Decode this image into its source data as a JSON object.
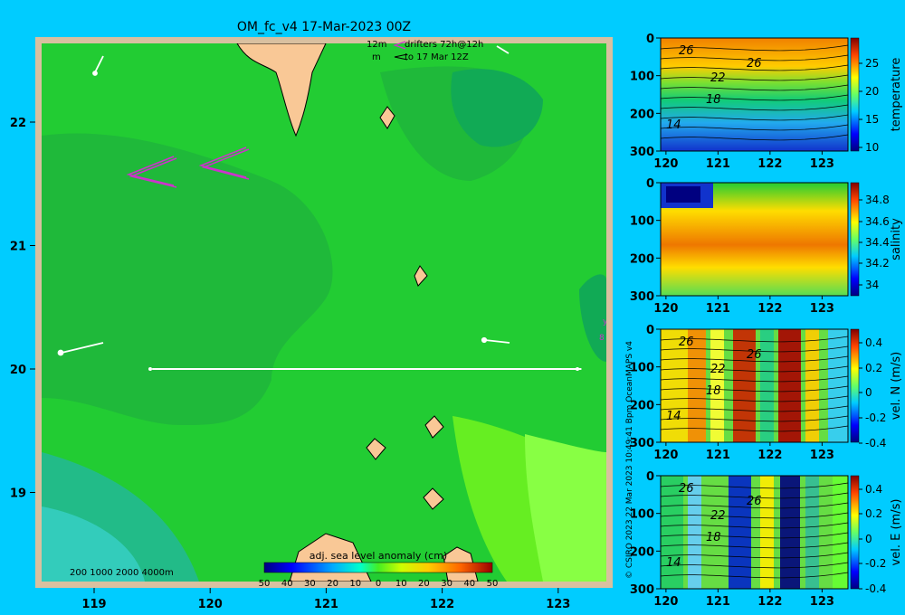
{
  "header": {
    "title": "OM_fc_v4  17-Mar-2023 00Z"
  },
  "drifter_legend": {
    "line1_a": "12m",
    "line1_b": "drifters 72h@12h",
    "line2_a": "m",
    "line2_b": "to 17 Mar 12Z"
  },
  "map": {
    "x_ticks": [
      "119",
      "120",
      "121",
      "122",
      "123"
    ],
    "y_ticks": [
      "22",
      "21",
      "20",
      "19"
    ],
    "colorbar": {
      "title": "adj. sea level anomaly (cm)",
      "ticks": [
        "-50",
        "-40",
        "-30",
        "-20",
        "-10",
        "0",
        "10",
        "20",
        "30",
        "40",
        "50"
      ]
    },
    "depth_legend": "200  1000  2000  4000m",
    "section_line": {
      "lat": 20,
      "lon_start": 119.5,
      "lon_end": 123.2
    }
  },
  "panels": [
    {
      "id": "temperature",
      "ylabel": "temperature",
      "colorbar_ticks": [
        "25",
        "20",
        "15",
        "10"
      ],
      "contour_labels": [
        "26",
        "26",
        "22",
        "18",
        "14"
      ]
    },
    {
      "id": "salinity",
      "ylabel": "salinity",
      "colorbar_ticks": [
        "34.8",
        "34.6",
        "34.4",
        "34.2",
        "34"
      ],
      "contour_labels": []
    },
    {
      "id": "vel-n",
      "ylabel": "vel. N (m/s)",
      "colorbar_ticks": [
        "0.4",
        "0.2",
        "0",
        "-0.2",
        "-0.4"
      ],
      "contour_labels": [
        "26",
        "26",
        "22",
        "18",
        "14"
      ]
    },
    {
      "id": "vel-e",
      "ylabel": "vel. E (m/s)",
      "colorbar_ticks": [
        "0.4",
        "0.2",
        "0",
        "-0.2",
        "-0.4"
      ],
      "contour_labels": [
        "26",
        "26",
        "22",
        "18",
        "14"
      ]
    }
  ],
  "section_axes": {
    "x_ticks": [
      "120",
      "121",
      "122",
      "123"
    ],
    "y_ticks": [
      "0",
      "100",
      "200",
      "300"
    ]
  },
  "credit": "© CSIRO 2023   22 Mar 2023 10:49:41 Bpm OceanMAPS v4",
  "colors": {
    "background": "#00ccff",
    "land": "#f9c896",
    "ocean_main": "#22cc33"
  }
}
